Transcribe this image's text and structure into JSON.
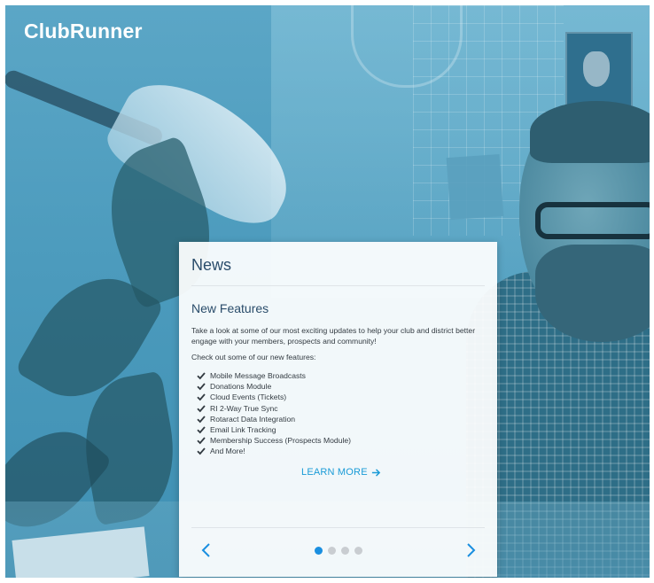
{
  "brand": {
    "logo_text": "ClubRunner"
  },
  "news": {
    "heading": "News",
    "article": {
      "title": "New Features",
      "intro": "Take a look at some of our most exciting updates to help your club and district better engage with your members, prospects and community!",
      "sub_intro": "Check out some of our new features:",
      "features": [
        "Mobile Message Broadcasts",
        "Donations Module",
        "Cloud Events (Tickets)",
        "RI 2-Way True Sync",
        "Rotaract Data Integration",
        "Email Link Tracking",
        "Membership Success (Prospects Module)",
        "And More!"
      ],
      "cta_label": "LEARN MORE"
    },
    "carousel": {
      "slide_count": 4,
      "active_index": 0
    }
  },
  "colors": {
    "heading": "#2b4d6b",
    "link": "#1a9bd7",
    "active_dot": "#1a8fe0",
    "inactive_dot": "#c9cdd1",
    "overlay": "#4c9bbd"
  },
  "icons": {
    "check": "check-icon",
    "arrow": "arrow-right-icon",
    "prev": "chevron-left-icon",
    "next": "chevron-right-icon"
  }
}
